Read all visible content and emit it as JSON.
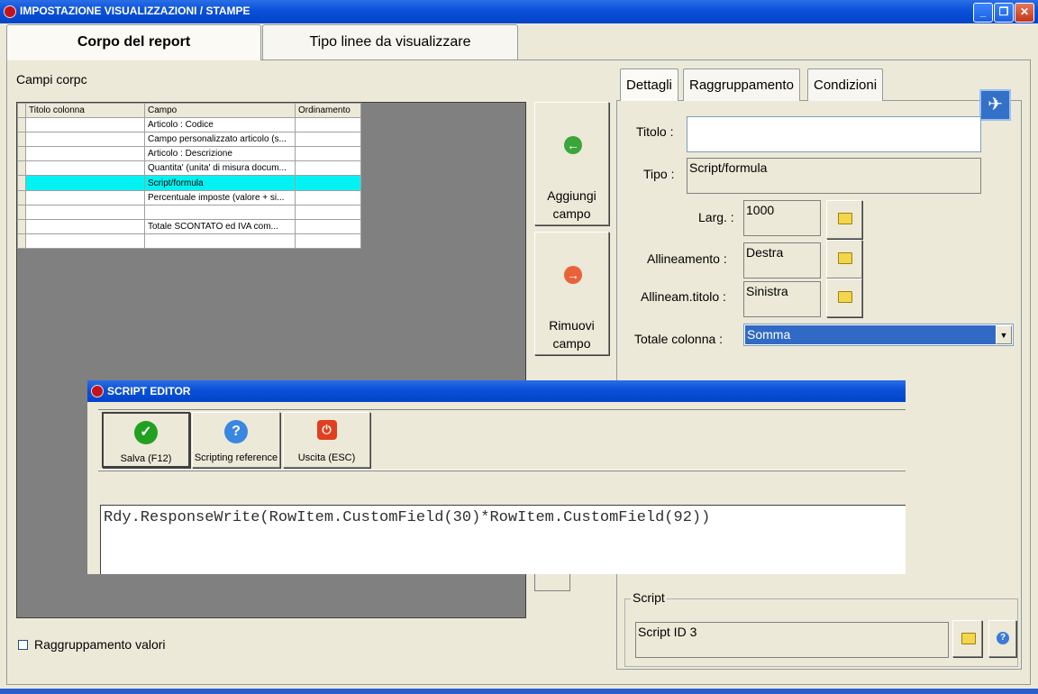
{
  "window": {
    "title": "IMPOSTAZIONE VISUALIZZAZIONI / STAMPE",
    "controls": {
      "minimize": "_",
      "restore": "❐",
      "close": "✕"
    }
  },
  "outer_tabs": [
    {
      "label": "Corpo del report",
      "active": true
    },
    {
      "label": "Tipo linee da visualizzare",
      "active": false
    }
  ],
  "left": {
    "section_label": "Campi corpc",
    "grid": {
      "headers": [
        "Titolo colonna",
        "Campo",
        "Ordinamento"
      ],
      "rows": [
        [
          "",
          "Articolo : Codice",
          ""
        ],
        [
          "",
          "Campo personalizzato articolo (s...",
          ""
        ],
        [
          "",
          "Articolo : Descrizione",
          ""
        ],
        [
          "",
          "Quantita' (unita' di misura docum...",
          ""
        ],
        [
          "",
          "Script/formula",
          ""
        ],
        [
          "",
          "Percentuale imposte (valore + si...",
          ""
        ],
        [
          "",
          "",
          ""
        ],
        [
          "",
          "Totale SCONTATO ed IVA com...",
          ""
        ],
        [
          "",
          "",
          ""
        ]
      ],
      "selected_row": 4
    },
    "checkbox_label": "Raggruppamento valori"
  },
  "middle": {
    "add_button": {
      "line1": "Aggiungi",
      "line2": "campo"
    },
    "remove_button": {
      "line1": "Rimuovi",
      "line2": "campo"
    }
  },
  "right_tabs": [
    {
      "label": "Dettagli",
      "active": true
    },
    {
      "label": "Raggruppamento",
      "active": false
    },
    {
      "label": "Condizioni",
      "active": false
    }
  ],
  "details": {
    "titolo_label": "Titolo :",
    "titolo_value": "",
    "tipo_label": "Tipo :",
    "tipo_value": "Script/formula",
    "larg_label": "Larg. :",
    "larg_value": "1000",
    "allineamento_label": "Allineamento :",
    "allineamento_value": "Destra",
    "allineam_titolo_label": "Allineam.titolo :",
    "allineam_titolo_value": "Sinistra",
    "totale_label": "Totale colonna :",
    "totale_value": "Somma",
    "script_group_label": "Script",
    "script_value": "Script ID 3"
  },
  "script_editor": {
    "title": "SCRIPT EDITOR",
    "buttons": [
      {
        "label": "Salva (F12)",
        "icon": "checkmark-icon",
        "color": "#22a022"
      },
      {
        "label": "Scripting reference",
        "icon": "question-icon",
        "color": "#3a86e0"
      },
      {
        "label": "Uscita (ESC)",
        "icon": "power-icon",
        "color": "#e04020"
      }
    ],
    "code": "Rdy.ResponseWrite(RowItem.CustomField(30)*RowItem.CustomField(92))"
  },
  "colors": {
    "titlebar": "#0a50d8",
    "selection": "#00f2f2",
    "combo_selected": "#316ac5",
    "background": "#ece9d8"
  }
}
